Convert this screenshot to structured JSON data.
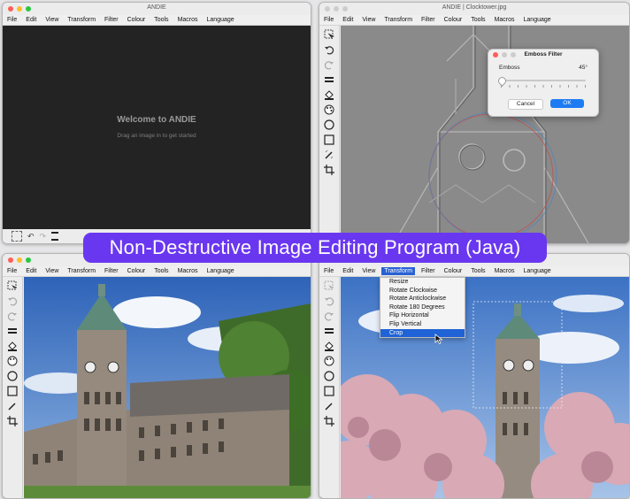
{
  "menu_labels": [
    "File",
    "Edit",
    "View",
    "Transform",
    "Filter",
    "Colour",
    "Tools",
    "Macros",
    "Language"
  ],
  "windows": {
    "top_left": {
      "title": "ANDIE",
      "welcome_title": "Welcome to ANDIE",
      "welcome_subtitle": "Drag an image in to get started"
    },
    "top_right": {
      "title": "ANDIE | Clocktower.jpg"
    },
    "bottom_left": {
      "title": ""
    },
    "bottom_right": {
      "title": "",
      "active_menu": "Transform"
    }
  },
  "emboss_dialog": {
    "title": "Emboss Filter",
    "label": "Emboss",
    "value": "45°",
    "slider_fraction": 0.0,
    "cancel_label": "Cancel",
    "ok_label": "OK"
  },
  "transform_menu": {
    "items": [
      "Resize",
      "Rotate Clockwise",
      "Rotate Anticlockwise",
      "Rotate 180 Degrees",
      "Flip Horizontal",
      "Flip Vertical",
      "Crop"
    ],
    "selected": "Crop"
  },
  "banner_text": "Non-Destructive Image Editing Program (Java)",
  "tool_icons": [
    "select-icon",
    "undo-icon",
    "redo-icon",
    "zoom-icon",
    "fill-icon",
    "palette-icon",
    "ellipse-icon",
    "rectangle-icon",
    "pen-icon",
    "crop-icon"
  ],
  "colors": {
    "accent": "#1e7cf2",
    "banner": "#6a37f0",
    "menu_selected": "#1f63d6",
    "dark_canvas": "#232323"
  }
}
